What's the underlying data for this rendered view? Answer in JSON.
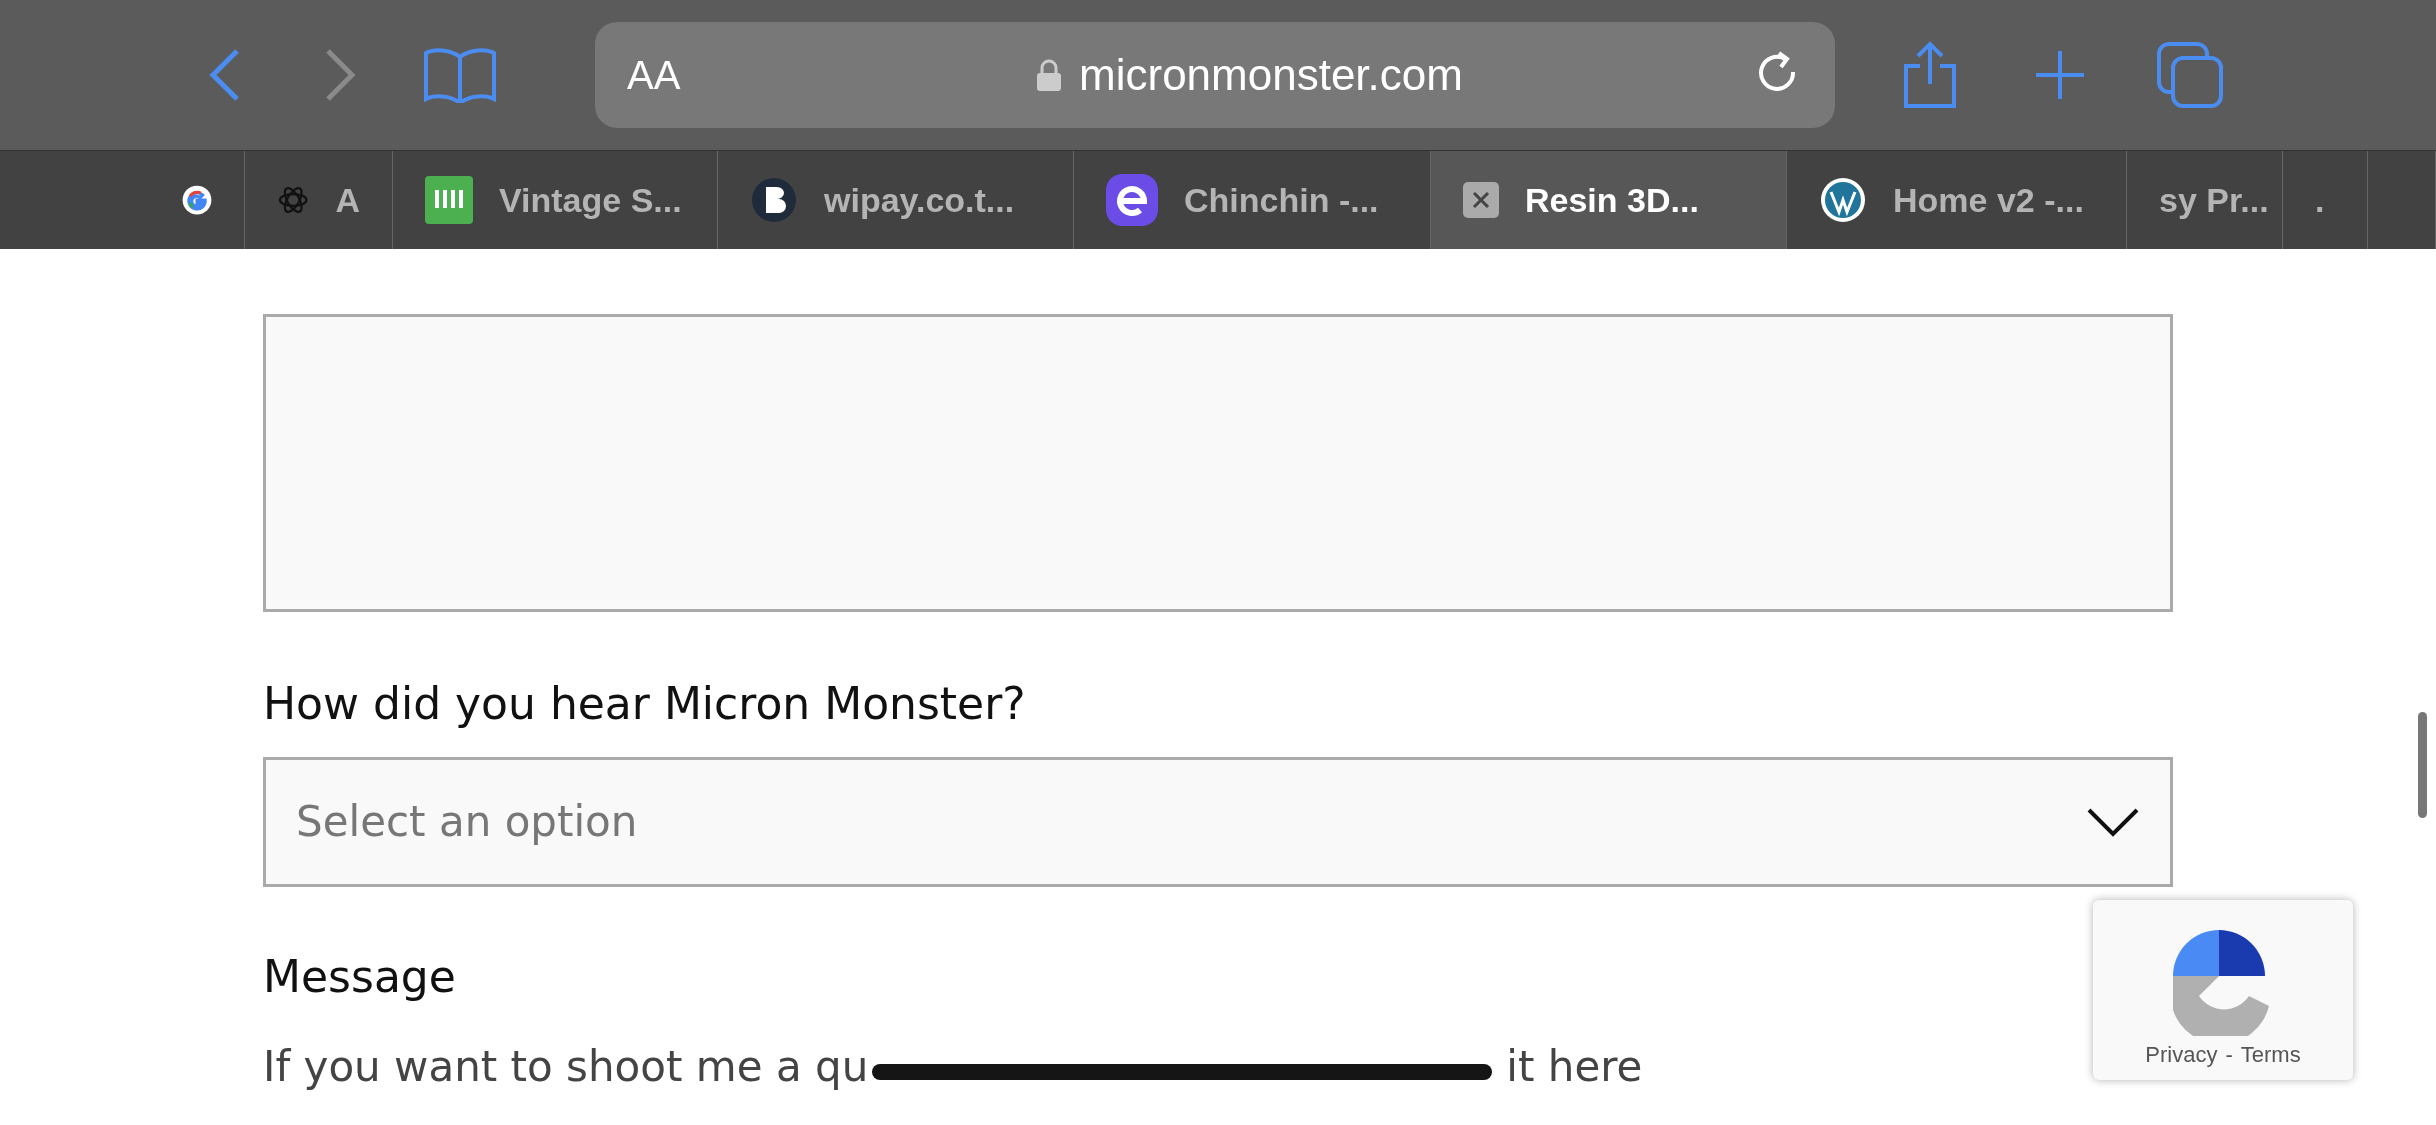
{
  "toolbar": {
    "back": {
      "disabled": false
    },
    "forward": {
      "disabled": true
    },
    "reader_label": "AA",
    "url": "micronmonster.com"
  },
  "tabs": [
    {
      "kind": "google",
      "selected": false
    },
    {
      "label": "A",
      "kind": "knot",
      "selected": false
    },
    {
      "label": "Vintage S...",
      "kind": "jiji",
      "selected": false
    },
    {
      "label": "wipay.co.t...",
      "kind": "letter-b",
      "selected": false
    },
    {
      "label": "Chinchin -...",
      "kind": "letter-e",
      "selected": false
    },
    {
      "label": "Resin 3D...",
      "kind": "close",
      "selected": true
    },
    {
      "label": "Home v2 -...",
      "kind": "wordpress",
      "selected": false
    },
    {
      "label": "sy Pr...",
      "kind": "none",
      "selected": false
    },
    {
      "label": ".",
      "kind": "none",
      "selected": false
    },
    {
      "kind": "none",
      "selected": false
    }
  ],
  "form": {
    "heard_label": "How did you hear Micron Monster?",
    "heard_select": {
      "placeholder": "Select an option"
    },
    "message_label": "Message",
    "message_help": [
      "If you want to shoot me a qu",
      "it here"
    ]
  },
  "recaptcha": {
    "privacy": "Privacy",
    "separator": "-",
    "terms": "Terms"
  }
}
